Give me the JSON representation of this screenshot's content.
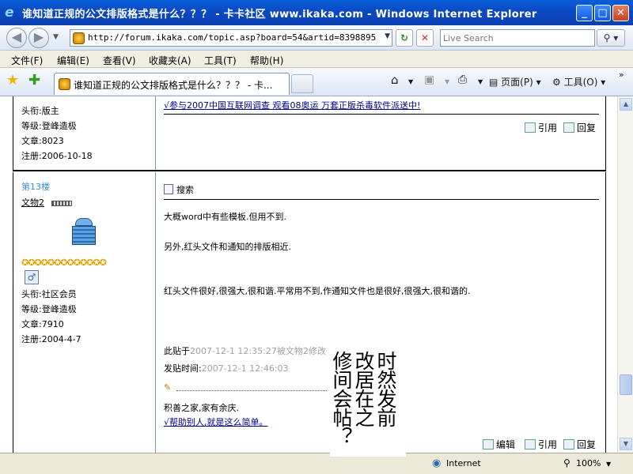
{
  "window": {
    "title": "谁知道正规的公文排版格式是什么？？？ - 卡卡社区 www.ikaka.com - Windows Internet Explorer",
    "min": "_",
    "max": "□",
    "close": "✕"
  },
  "address": {
    "url": "http://forum.ikaka.com/topic.asp?board=54&artid=8398895",
    "search_placeholder": "Live Search"
  },
  "menu": [
    "文件(F)",
    "编辑(E)",
    "查看(V)",
    "收藏夹(A)",
    "工具(T)",
    "帮助(H)"
  ],
  "tab": {
    "label": "谁知道正规的公文排版格式是什么？？？ - 卡..."
  },
  "commands": {
    "page": "页面(P)",
    "tools": "工具(O)"
  },
  "post_top": {
    "title_label": "头衔:版主",
    "level_label": "等级:登峰造极",
    "articles_label": "文章:8023",
    "reg_label": "注册:2006-10-18",
    "sig_link": "√参与2007中国互联网调查 观看08奥运 万套正版杀毒软件派送中!",
    "quote": "引用",
    "reply": "回复"
  },
  "post13": {
    "floor": "第13楼",
    "user": "文物2",
    "title_label": "头衔:社区会员",
    "level_label": "等级:登峰造极",
    "articles_label": "文章:7910",
    "reg_label": "注册:2004-4-7",
    "search_label": "搜索",
    "line1": "大概word中有些模板.但用不到.",
    "line2": "另外,红头文件和通知的排版相近.",
    "line3": "红头文件很好,很强大,很和谐.平常用不到,作通知文件也是很好,很强大,很和谐的.",
    "edit_prefix": "此贴于",
    "edit_info": "2007-12-1 12:35:27被文物2修改",
    "post_prefix": "发贴时间:",
    "post_time": "2007-12-1 12:46:03",
    "sig1": "积善之家,家有余庆.",
    "sig2": "√帮助别人,就是这么简单。",
    "edit": "编辑",
    "quote": "引用",
    "reply": "回复"
  },
  "overlay_chars": [
    "时然发前",
    "改居在之",
    "修间会帖？"
  ],
  "status": {
    "zone": "Internet",
    "zoom": "100%"
  }
}
